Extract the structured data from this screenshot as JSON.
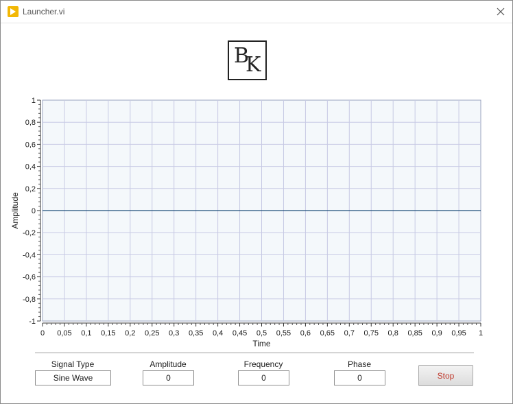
{
  "window": {
    "title": "Launcher.vi"
  },
  "logo": {
    "letters": [
      "B",
      "K"
    ]
  },
  "chart_data": {
    "type": "line",
    "xlabel": "Time",
    "ylabel": "Amplitude",
    "xlim": [
      0,
      1
    ],
    "ylim": [
      -1,
      1
    ],
    "x_ticks": [
      "0",
      "0,05",
      "0,1",
      "0,15",
      "0,2",
      "0,25",
      "0,3",
      "0,35",
      "0,4",
      "0,45",
      "0,5",
      "0,55",
      "0,6",
      "0,65",
      "0,7",
      "0,75",
      "0,8",
      "0,85",
      "0,9",
      "0,95",
      "1"
    ],
    "y_ticks": [
      "1",
      "0,8",
      "0,6",
      "0,4",
      "0,2",
      "0",
      "-0,2",
      "-0,4",
      "-0,6",
      "-0,8",
      "-1"
    ],
    "grid": true,
    "series": [
      {
        "x": [
          0,
          1
        ],
        "y": [
          0,
          0
        ],
        "color": "#1f4e79"
      }
    ],
    "colors": {
      "plot_bg": "#f4f8fb",
      "grid": "#c7c9e4"
    }
  },
  "controls": {
    "signal_type": {
      "label": "Signal Type",
      "value": "Sine Wave"
    },
    "amplitude": {
      "label": "Amplitude",
      "value": "0"
    },
    "frequency": {
      "label": "Frequency",
      "value": "0"
    },
    "phase": {
      "label": "Phase",
      "value": "0"
    },
    "stop": {
      "label": "Stop"
    }
  },
  "colors": {
    "stop_text": "#c0392b",
    "app_icon": "#f2b705"
  }
}
